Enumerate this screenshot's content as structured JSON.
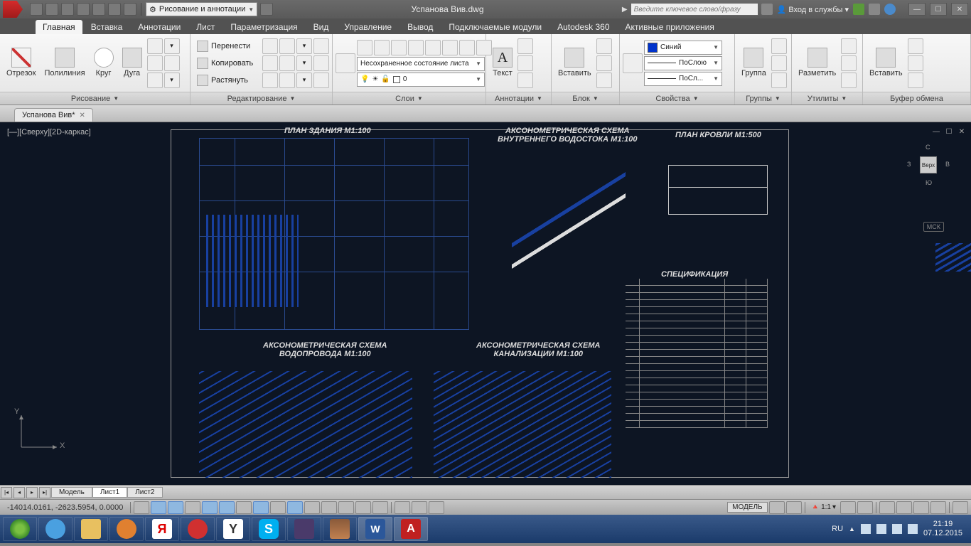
{
  "titlebar": {
    "workspace": "Рисование и аннотации",
    "filename": "Успанова Вив.dwg",
    "search_placeholder": "Введите ключевое слово/фразу",
    "signin": "Вход в службы"
  },
  "tabs": {
    "items": [
      "Главная",
      "Вставка",
      "Аннотации",
      "Лист",
      "Параметризация",
      "Вид",
      "Управление",
      "Вывод",
      "Подключаемые модули",
      "Autodesk 360",
      "Активные приложения"
    ],
    "active": 0
  },
  "ribbon": {
    "draw": {
      "title": "Рисование",
      "line": "Отрезок",
      "polyline": "Полилиния",
      "circle": "Круг",
      "arc": "Дуга"
    },
    "modify": {
      "title": "Редактирование",
      "move": "Перенести",
      "copy": "Копировать",
      "stretch": "Растянуть"
    },
    "layers": {
      "title": "Слои",
      "state": "Несохраненное состояние листа",
      "current": "0"
    },
    "annotation": {
      "title": "Аннотации",
      "text": "Текст"
    },
    "block": {
      "title": "Блок",
      "insert": "Вставить"
    },
    "properties": {
      "title": "Свойства",
      "color": "Синий",
      "lineweight": "ПоСлою",
      "linetype": "ПоСл..."
    },
    "groups": {
      "title": "Группы",
      "group": "Группа"
    },
    "utilities": {
      "title": "Утилиты",
      "measure": "Разметить"
    },
    "clipboard": {
      "title": "Буфер обмена",
      "paste": "Вставить"
    }
  },
  "filetab": {
    "name": "Успанова Вив*"
  },
  "drawing": {
    "viewctrl": "[—][Сверху][2D-каркас]",
    "labels": {
      "plan": "ПЛАН  ЗДАНИЯ  M1:100",
      "axo_drain": "АКСОНОМЕТРИЧЕСКАЯ СХЕМА\nВНУТРЕННЕГО ВОДОСТОКА M1:100",
      "roof": "ПЛАН КРОВЛИ  M1:500",
      "spec": "СПЕЦИФИКАЦИЯ",
      "axo_water": "АКСОНОМЕТРИЧЕСКАЯ СХЕМА\nВОДОПРОВОДА M1:100",
      "axo_sewer": "АКСОНОМЕТРИЧЕСКАЯ СХЕМА\nКАНАЛИЗАЦИИ M1:100"
    },
    "viewcube": {
      "top": "Верх",
      "n": "С",
      "s": "Ю",
      "e": "В",
      "w": "З",
      "wcs": "МСК"
    },
    "ucs": {
      "x": "X",
      "y": "Y"
    }
  },
  "layout": {
    "tabs": [
      "Модель",
      "Лист1",
      "Лист2"
    ],
    "active": 1
  },
  "status": {
    "coords": "-14014.0161, -2623.5954, 0.0000",
    "model": "МОДЕЛЬ",
    "scale": "1:1"
  },
  "taskbar": {
    "lang": "RU",
    "time": "21:19",
    "date": "07.12.2015"
  }
}
